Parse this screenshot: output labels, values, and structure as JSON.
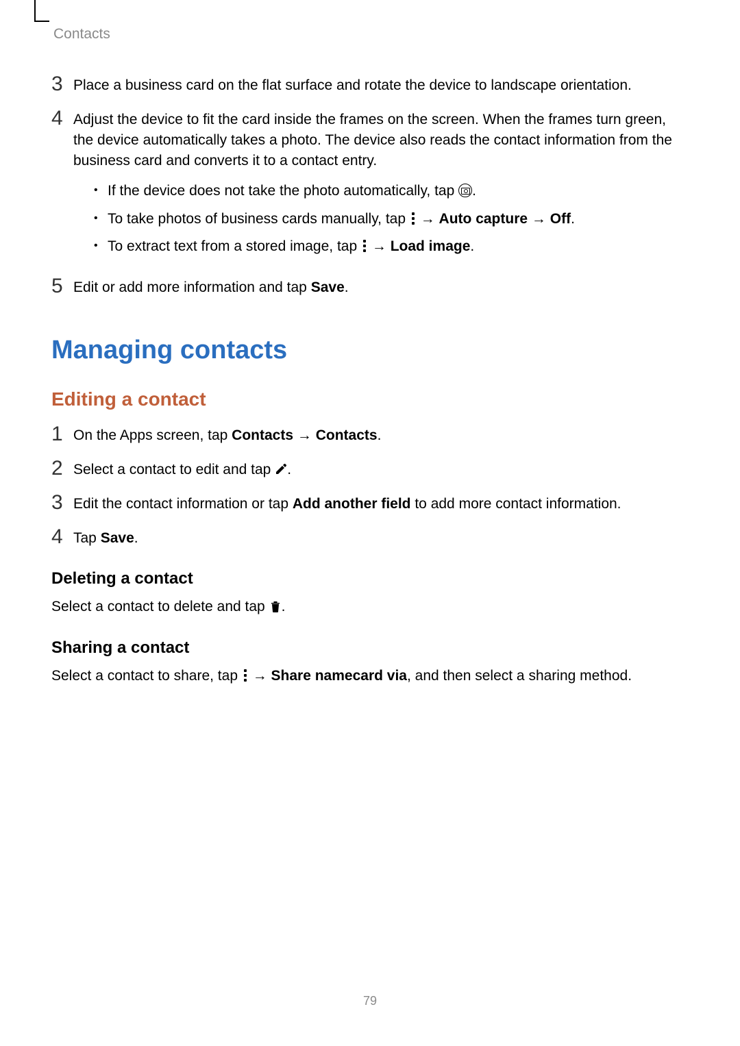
{
  "breadcrumb": "Contacts",
  "page_number": "79",
  "arrow": "→",
  "steps_top": {
    "s3_num": "3",
    "s3": "Place a business card on the flat surface and rotate the device to landscape orientation.",
    "s4_num": "4",
    "s4": "Adjust the device to fit the card inside the frames on the screen. When the frames turn green, the device automatically takes a photo. The device also reads the contact information from the business card and converts it to a contact entry.",
    "s4_b1a": "If the device does not take the photo automatically, tap ",
    "s4_b1b": ".",
    "s4_b2a": "To take photos of business cards manually, tap ",
    "s4_b2_bold1": "Auto capture",
    "s4_b2_bold2": "Off",
    "s4_b2b": ".",
    "s4_b3a": "To extract text from a stored image, tap ",
    "s4_b3_bold": "Load image",
    "s4_b3b": ".",
    "s5_num": "5",
    "s5a": "Edit or add more information and tap ",
    "s5_bold": "Save",
    "s5b": "."
  },
  "section_title": "Managing contacts",
  "editing": {
    "title": "Editing a contact",
    "s1_num": "1",
    "s1a": "On the Apps screen, tap ",
    "s1_bold1": "Contacts",
    "s1_bold2": "Contacts",
    "s1b": ".",
    "s2_num": "2",
    "s2a": "Select a contact to edit and tap ",
    "s2b": ".",
    "s3_num": "3",
    "s3a": "Edit the contact information or tap ",
    "s3_bold": "Add another field",
    "s3b": " to add more contact information.",
    "s4_num": "4",
    "s4a": "Tap ",
    "s4_bold": "Save",
    "s4b": "."
  },
  "deleting": {
    "title": "Deleting a contact",
    "body_a": "Select a contact to delete and tap ",
    "body_b": "."
  },
  "sharing": {
    "title": "Sharing a contact",
    "body_a": "Select a contact to share, tap ",
    "body_bold": "Share namecard via",
    "body_b": ", and then select a sharing method."
  }
}
